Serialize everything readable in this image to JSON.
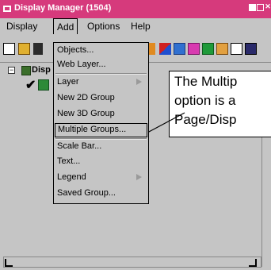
{
  "window": {
    "title": "Display Manager (1504)"
  },
  "menubar": {
    "items": [
      "Display",
      "Add",
      "Options",
      "Help"
    ]
  },
  "tree": {
    "root_label": "Disp",
    "expander": "⊟"
  },
  "add_menu": {
    "items": [
      {
        "label": "Objects...",
        "submenu": false
      },
      {
        "label": "Web Layer...",
        "submenu": false
      },
      {
        "label": "Layer",
        "submenu": true
      },
      {
        "label": "New 2D Group",
        "submenu": false
      },
      {
        "label": "New 3D Group",
        "submenu": false
      },
      {
        "label": "Multiple Groups...",
        "submenu": false,
        "selected": true
      },
      {
        "label": "Scale Bar...",
        "submenu": false
      },
      {
        "label": "Text...",
        "submenu": false
      },
      {
        "label": "Legend",
        "submenu": true
      },
      {
        "label": "Saved Group...",
        "submenu": false
      }
    ]
  },
  "callout": {
    "lines": [
      "The Multip",
      "option is a",
      "Page/Disp"
    ]
  },
  "colors": {
    "titlebar": "#d63a7c",
    "window_bg": "#c5c5c5"
  }
}
